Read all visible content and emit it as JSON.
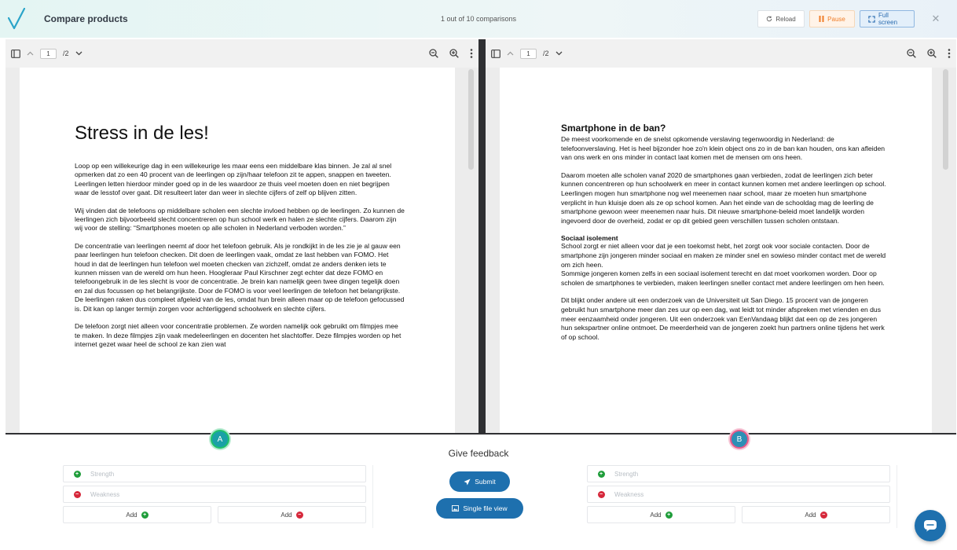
{
  "header": {
    "title": "Compare products",
    "counter": "1 out of 10 comparisons",
    "reload_label": "Reload",
    "pause_label": "Pause",
    "fullscreen_label": "Full screen",
    "close_label": "✕"
  },
  "viewer_left": {
    "page_current": "1",
    "page_total": "/2",
    "doc": {
      "title": "Stress in de les!",
      "paragraphs": [
        "Loop op een willekeurige dag in een willekeurige les maar eens een middelbare klas binnen. Je zal al snel opmerken dat zo een 40 procent van de leerlingen op zijn/haar telefoon zit te appen, snappen en tweeten. Leerlingen letten hierdoor minder goed op in de les waardoor ze thuis veel moeten doen en niet begrijpen waar de lesstof over gaat. Dit resulteert later dan weer in slechte cijfers of zelf op blijven zitten.",
        "Wij vinden dat de telefoons op middelbare scholen een slechte invloed hebben op de leerlingen. Zo kunnen de leerlingen zich bijvoorbeeld slecht concentreren op hun school werk en halen ze slechte cijfers. Daarom zijn wij voor de stelling: “Smartphones moeten op alle scholen in Nederland verboden worden.”",
        "De concentratie van leerlingen neemt af door het telefoon gebruik. Als je rondkijkt in de les zie je al gauw een paar leerlingen hun telefoon checken. Dit doen de leerlingen vaak, omdat ze last hebben van FOMO. Het houd in dat de leerlingen hun telefoon wel moeten checken van zichzelf, omdat ze anders denken iets te kunnen missen van de wereld om hun heen. Hoogleraar Paul Kirschner zegt echter dat deze FOMO en telefoongebruik in de les slecht is voor de concentratie. Je brein kan namelijk geen twee dingen tegelijk doen en zal dus focussen op het belangrijkste. Door de FOMO is voor veel leerlingen de telefoon het belangrijkste. De leerlingen raken dus compleet afgeleid van de les, omdat hun brein alleen maar op de telefoon gefocussed is. Dit kan op langer termijn zorgen voor achterliggend schoolwerk en slechte cijfers.",
        "De telefoon zorgt niet alleen voor concentratie problemen. Ze worden namelijk ook gebruikt om filmpjes mee te maken. In deze filmpjes zijn vaak medeleerlingen en docenten het slachtoffer. Deze filmpjes worden op het internet gezet waar heel de school ze kan zien wat"
      ]
    }
  },
  "viewer_right": {
    "page_current": "1",
    "page_total": "/2",
    "doc": {
      "heading1": "Smartphone in de ban?",
      "p1": "De meest voorkomende en de snelst opkomende verslaving tegenwoordig in Nederland: de telefoonverslaving. Het is heel bijzonder hoe zo'n klein object ons zo in de ban kan houden, ons kan afleiden van ons werk en ons minder in contact laat komen met de mensen om ons heen.",
      "p2": "Daarom moeten alle scholen vanaf 2020 de smartphones gaan verbieden, zodat de leerlingen zich beter kunnen concentreren op hun schoolwerk en meer in contact kunnen komen met andere leerlingen op school. Leerlingen mogen hun smartphone nog wel meenemen naar school, maar ze moeten hun smartphone verplicht in hun kluisje doen als ze op school komen. Aan het einde van de schooldag mag de leerling de smartphone gewoon weer meenemen naar huis. Dit nieuwe smartphone-beleid moet landelijk worden ingevoerd door de overheid, zodat er op dit gebied geen verschillen tussen scholen ontstaan.",
      "heading2": "Sociaal isolement",
      "p3": "School zorgt er niet alleen voor dat je een toekomst hebt, het zorgt ook voor sociale contacten. Door de smartphone zijn jongeren minder sociaal en maken ze minder snel en sowieso minder contact met de wereld om zich heen.",
      "p4": "Sommige jongeren komen zelfs in een sociaal isolement terecht en dat moet voorkomen worden. Door op scholen de smartphones te verbieden, maken leerlingen sneller contact met andere leerlingen om hen heen.",
      "p5": "Dit blijkt onder andere uit een onderzoek van de Universiteit uit San Diego. 15 procent van de jongeren gebruikt hun smartphone meer dan zes uur op een dag, wat leidt tot minder afspreken met vrienden en dus meer eenzaamheid onder jongeren. Uit een onderzoek van EenVandaag blijkt dat een op de zes jongeren hun sekspartner online ontmoet. De meerderheid van de jongeren zoekt hun partners online tijdens het werk of op school."
    }
  },
  "badges": {
    "a": "A",
    "b": "B"
  },
  "feedback": {
    "title": "Give feedback",
    "strength_placeholder": "Strength",
    "weakness_placeholder": "Weakness",
    "add_label": "Add",
    "submit_label": "Submit",
    "single_file_label": "Single file view"
  },
  "colors": {
    "accent": "#1e70ae",
    "positive": "#1f9d3a",
    "negative": "#d6283b",
    "pause": "#f07d28",
    "logo": "#2aa4c9"
  }
}
